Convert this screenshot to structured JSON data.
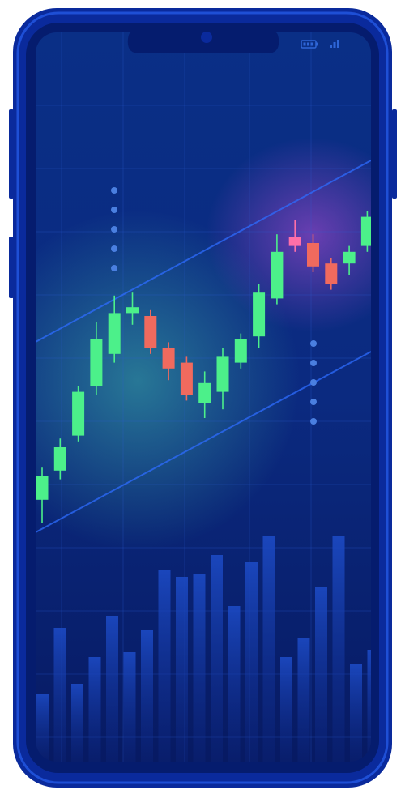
{
  "status_bar": {
    "battery_icon": "battery-icon",
    "signal_icon": "signal-icon"
  },
  "colors": {
    "frame": "#0a2a9c",
    "frame_edge": "#1740c8",
    "screen_top": "#0a2f86",
    "screen_bottom": "#071a63",
    "bullish": "#4cf08a",
    "bearish": "#f06a5e",
    "bearish_highlight": "#ff6fa8",
    "channel_line": "#2e6cff",
    "volume_bar": "#1a43b8",
    "dots": "#4a7fe0"
  },
  "chart_data": [
    {
      "type": "candlestick",
      "title": "",
      "xlabel": "",
      "ylabel": "",
      "grid": true,
      "ylim": [
        0,
        100
      ],
      "candles": [
        {
          "open": 12,
          "close": 20,
          "high": 23,
          "low": 4,
          "dir": "up"
        },
        {
          "open": 22,
          "close": 30,
          "high": 33,
          "low": 19,
          "dir": "up"
        },
        {
          "open": 34,
          "close": 49,
          "high": 51,
          "low": 32,
          "dir": "up"
        },
        {
          "open": 51,
          "close": 67,
          "high": 73,
          "low": 48,
          "dir": "up"
        },
        {
          "open": 62,
          "close": 76,
          "high": 82,
          "low": 59,
          "dir": "up"
        },
        {
          "open": 76,
          "close": 78,
          "high": 83,
          "low": 72,
          "dir": "up"
        },
        {
          "open": 75,
          "close": 64,
          "high": 77,
          "low": 62,
          "dir": "down"
        },
        {
          "open": 64,
          "close": 57,
          "high": 66,
          "low": 53,
          "dir": "down"
        },
        {
          "open": 59,
          "close": 48,
          "high": 61,
          "low": 46,
          "dir": "down"
        },
        {
          "open": 45,
          "close": 52,
          "high": 56,
          "low": 40,
          "dir": "up"
        },
        {
          "open": 49,
          "close": 61,
          "high": 64,
          "low": 43,
          "dir": "up"
        },
        {
          "open": 59,
          "close": 67,
          "high": 69,
          "low": 57,
          "dir": "up"
        },
        {
          "open": 68,
          "close": 83,
          "high": 86,
          "low": 64,
          "dir": "up"
        },
        {
          "open": 81,
          "close": 97,
          "high": 103,
          "low": 79,
          "dir": "up"
        },
        {
          "open": 102,
          "close": 99,
          "high": 108,
          "low": 97,
          "dir": "down",
          "highlight": true
        },
        {
          "open": 100,
          "close": 92,
          "high": 103,
          "low": 90,
          "dir": "down"
        },
        {
          "open": 93,
          "close": 86,
          "high": 95,
          "low": 84,
          "dir": "down"
        },
        {
          "open": 93,
          "close": 97,
          "high": 99,
          "low": 89,
          "dir": "up"
        },
        {
          "open": 99,
          "close": 109,
          "high": 111,
          "low": 97,
          "dir": "up"
        }
      ]
    },
    {
      "type": "bar",
      "title": "",
      "xlabel": "",
      "ylabel": "",
      "ylim": [
        0,
        100
      ],
      "values": [
        28,
        55,
        32,
        43,
        60,
        45,
        54,
        79,
        76,
        77,
        85,
        64,
        82,
        93,
        43,
        51,
        72,
        93,
        40,
        46
      ]
    }
  ]
}
